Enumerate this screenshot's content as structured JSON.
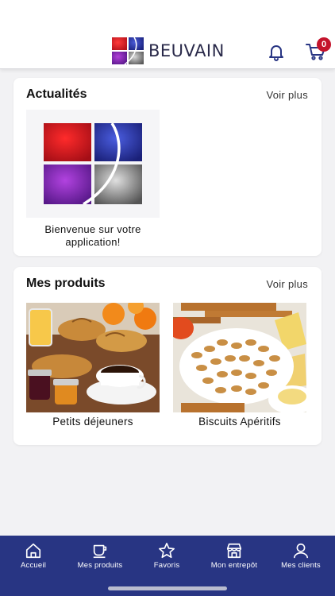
{
  "header": {
    "brand": "BEUVAIN",
    "logo_icon": "beuvain-logo",
    "notifications_icon": "bell-icon",
    "cart_icon": "cart-icon",
    "cart_count": "0",
    "badge_color": "#c4142c"
  },
  "news": {
    "title": "Actualités",
    "more": "Voir plus",
    "items": [
      {
        "caption": "Bienvenue sur votre application!"
      }
    ]
  },
  "products": {
    "title": "Mes produits",
    "more": "Voir plus",
    "items": [
      {
        "caption": "Petits déjeuners",
        "image": "breakfast-photo"
      },
      {
        "caption": "Biscuits Apéritifs",
        "image": "snacks-photo"
      }
    ]
  },
  "nav": {
    "background": "#283583",
    "items": [
      {
        "label": "Accueil",
        "icon": "home-icon"
      },
      {
        "label": "Mes produits",
        "icon": "cup-icon"
      },
      {
        "label": "Favoris",
        "icon": "star-icon"
      },
      {
        "label": "Mon entrepôt",
        "icon": "store-icon"
      },
      {
        "label": "Mes clients",
        "icon": "user-icon"
      }
    ]
  }
}
